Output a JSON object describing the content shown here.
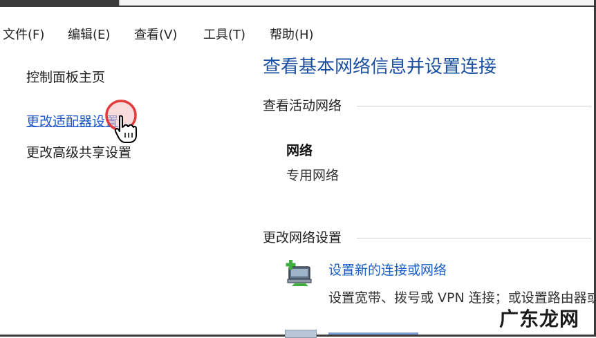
{
  "menu": {
    "file": "文件(F)",
    "edit": "编辑(E)",
    "view": "查看(V)",
    "tools": "工具(T)",
    "help": "帮助(H)"
  },
  "nav": {
    "home": "控制面板主页",
    "adapter_settings": "更改适配器设置",
    "advanced_sharing": "更改高级共享设置"
  },
  "main": {
    "title": "查看基本网络信息并设置连接",
    "active_networks_heading": "查看活动网络",
    "network_name": "网络",
    "network_type": "专用网络",
    "change_settings_heading": "更改网络设置",
    "setup_link": "设置新的连接或网络",
    "setup_desc": "设置宽带、拨号或 VPN 连接；或设置路由器或接入点。"
  },
  "icons": {
    "setup_connection": "network-setup-icon",
    "cursor": "hand-pointer-icon"
  },
  "watermark": "广东龙网",
  "colors": {
    "link": "#1a56c8",
    "title": "#1a4ea0",
    "highlight": "#e23c3c"
  }
}
